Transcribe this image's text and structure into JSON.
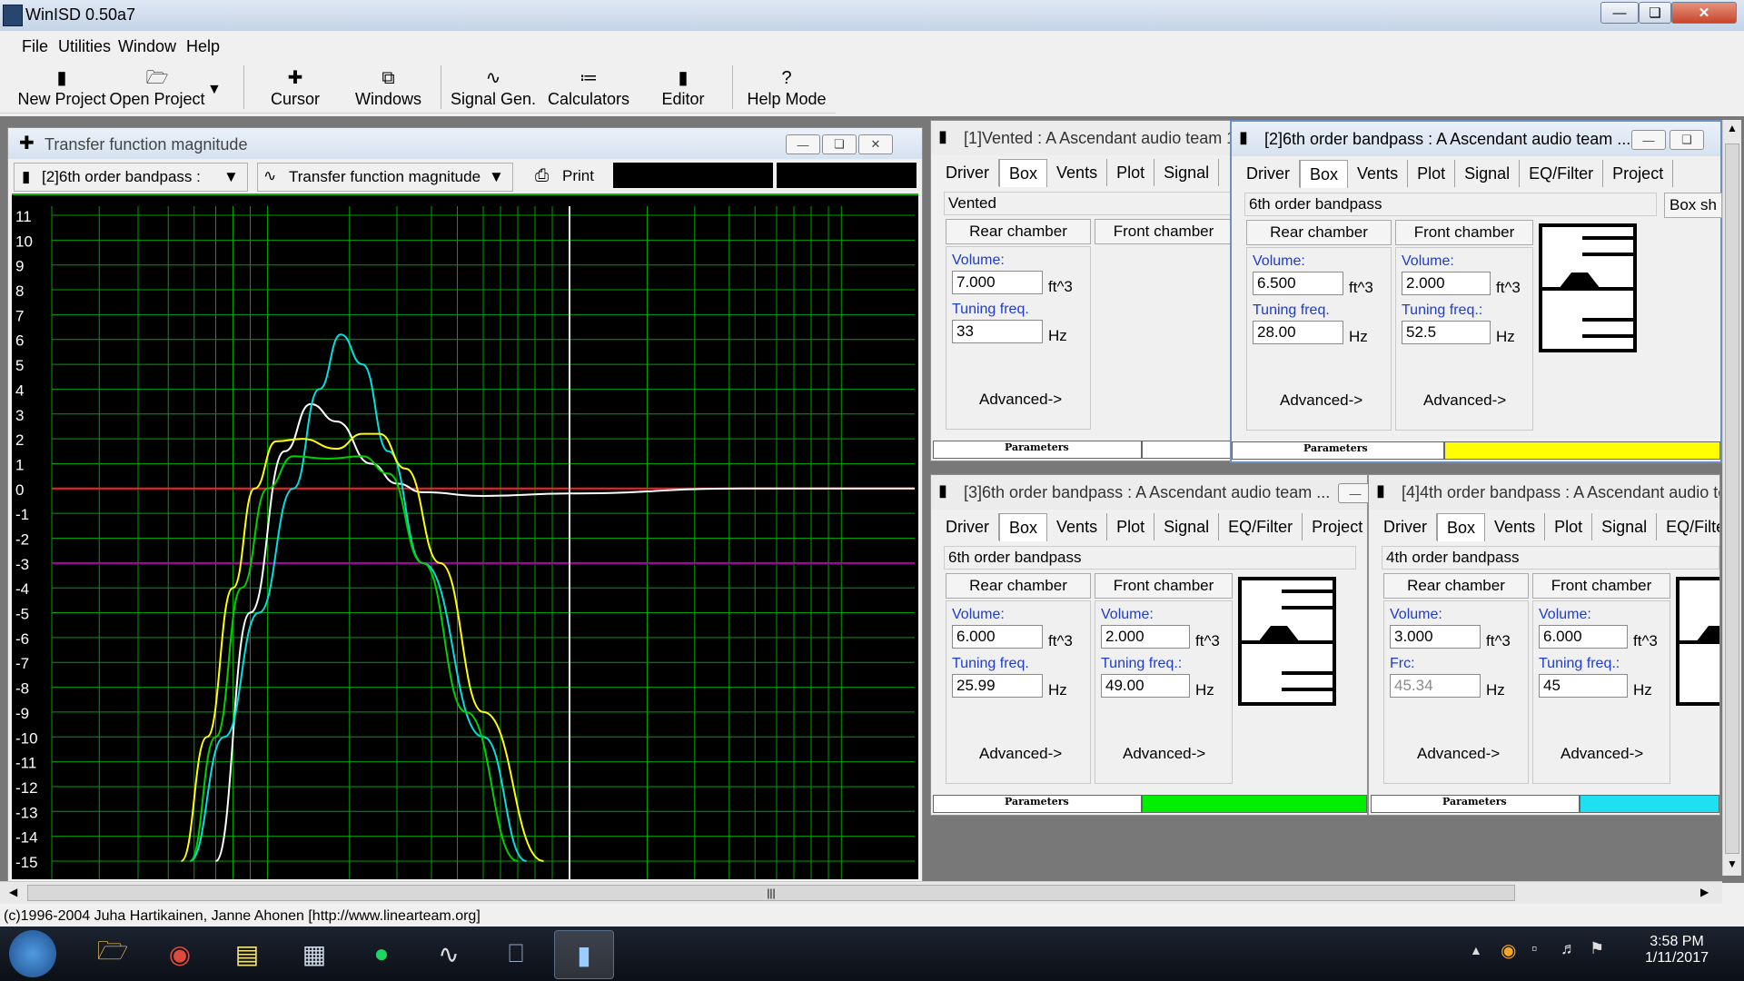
{
  "app": {
    "title": "WinISD 0.50a7"
  },
  "menu": [
    "File",
    "Utilities",
    "Window",
    "Help"
  ],
  "toolbar": [
    "New Project",
    "Open Project",
    "Cursor",
    "Windows",
    "Signal Gen.",
    "Calculators",
    "Editor",
    "Help Mode"
  ],
  "chart_window": {
    "title": "Transfer function magnitude",
    "project_select": "[2]6th order bandpass :",
    "graph_select": "Transfer function magnitude",
    "print_label": "Print"
  },
  "chart_data": {
    "type": "line",
    "y_ticks": [
      "11",
      "10",
      "9",
      "8",
      "7",
      "6",
      "5",
      "4",
      "3",
      "2",
      "1",
      "0",
      "-1",
      "-2",
      "-3",
      "-4",
      "-5",
      "-6",
      "-7",
      "-8",
      "-9",
      "-10",
      "-11",
      "-12",
      "-13",
      "-14",
      "-15"
    ],
    "ylim": [
      -15,
      11
    ],
    "grid": true,
    "cursor_line": true,
    "reference_lines": [
      {
        "y": 0,
        "color": "#ff2020"
      },
      {
        "y": -3,
        "color": "#b000b0"
      }
    ],
    "series": [
      {
        "color": "#ffffff",
        "values": [
          [
            0.19,
            -15
          ],
          [
            0.23,
            -5
          ],
          [
            0.27,
            1.5
          ],
          [
            0.3,
            3.4
          ],
          [
            0.33,
            2.7
          ],
          [
            0.37,
            1
          ],
          [
            0.4,
            0.2
          ],
          [
            0.43,
            -0.15
          ],
          [
            0.5,
            -0.3
          ],
          [
            0.6,
            -0.2
          ],
          [
            0.8,
            0
          ],
          [
            1,
            0
          ]
        ]
      },
      {
        "color": "#00e0e0",
        "values": [
          [
            0.16,
            -15
          ],
          [
            0.2,
            -10
          ],
          [
            0.24,
            -5
          ],
          [
            0.28,
            0
          ],
          [
            0.31,
            4
          ],
          [
            0.335,
            6.2
          ],
          [
            0.36,
            5
          ],
          [
            0.39,
            1.5
          ],
          [
            0.43,
            -3
          ],
          [
            0.5,
            -10
          ],
          [
            0.55,
            -15
          ]
        ]
      },
      {
        "color": "#ffff00",
        "values": [
          [
            0.15,
            -15
          ],
          [
            0.18,
            -10
          ],
          [
            0.21,
            -4
          ],
          [
            0.235,
            0
          ],
          [
            0.26,
            1.9
          ],
          [
            0.29,
            2
          ],
          [
            0.33,
            1.6
          ],
          [
            0.36,
            2.2
          ],
          [
            0.38,
            2.2
          ],
          [
            0.41,
            0.8
          ],
          [
            0.45,
            -3
          ],
          [
            0.5,
            -9
          ],
          [
            0.57,
            -15
          ]
        ]
      },
      {
        "color": "#00d000",
        "values": [
          [
            0.16,
            -15
          ],
          [
            0.19,
            -10
          ],
          [
            0.22,
            -4
          ],
          [
            0.25,
            0
          ],
          [
            0.28,
            1.3
          ],
          [
            0.32,
            1.2
          ],
          [
            0.36,
            1.3
          ],
          [
            0.39,
            0.6
          ],
          [
            0.43,
            -3
          ],
          [
            0.48,
            -9
          ],
          [
            0.54,
            -15
          ]
        ]
      }
    ]
  },
  "panels": [
    {
      "title": "[1]Vented : A Ascendant audio team 1",
      "tabs": [
        "Driver",
        "Box",
        "Vents",
        "Plot",
        "Signal"
      ],
      "box_type": "Vented",
      "rear": {
        "label": "Rear chamber",
        "volume": "7.000",
        "tuning_label": "Tuning freq.",
        "tuning": "33"
      },
      "front": {
        "label": "Front chamber"
      },
      "footer": "Parameters",
      "color": "#ffffff"
    },
    {
      "title": "[2]6th order bandpass : A Ascendant audio team ...",
      "tabs": [
        "Driver",
        "Box",
        "Vents",
        "Plot",
        "Signal",
        "EQ/Filter",
        "Project"
      ],
      "box_type": "6th order bandpass",
      "box_sh": "Box sh",
      "rear": {
        "label": "Rear chamber",
        "volume": "6.500",
        "tuning_label": "Tuning freq.",
        "tuning": "28.00"
      },
      "front": {
        "label": "Front chamber",
        "volume": "2.000",
        "tuning_label": "Tuning freq.:",
        "tuning": "52.5"
      },
      "footer": "Parameters",
      "color": "#ffff00"
    },
    {
      "title": "[3]6th order bandpass : A Ascendant audio team ...",
      "tabs": [
        "Driver",
        "Box",
        "Vents",
        "Plot",
        "Signal",
        "EQ/Filter",
        "Project"
      ],
      "box_type": "6th order bandpass",
      "rear": {
        "label": "Rear chamber",
        "volume": "6.000",
        "tuning_label": "Tuning freq.",
        "tuning": "25.99"
      },
      "front": {
        "label": "Front chamber",
        "volume": "2.000",
        "tuning_label": "Tuning freq.:",
        "tuning": "49.00"
      },
      "footer": "Parameters",
      "color": "#00ee00"
    },
    {
      "title": "[4]4th order bandpass : A Ascendant audio te",
      "tabs": [
        "Driver",
        "Box",
        "Vents",
        "Plot",
        "Signal",
        "EQ/Filte"
      ],
      "box_type": "4th order bandpass",
      "rear": {
        "label": "Rear chamber",
        "volume": "3.000",
        "tuning_label": "Frc:",
        "tuning": "45.34"
      },
      "front": {
        "label": "Front chamber",
        "volume": "6.000",
        "tuning_label": "Tuning freq.:",
        "tuning": "45"
      },
      "footer": "Parameters",
      "color": "#1ee0f0"
    }
  ],
  "units": {
    "volume": "ft^3",
    "freq": "Hz"
  },
  "advanced_label": "Advanced->",
  "statusbar": {
    "text": "(c)1996-2004 Juha Hartikainen, Janne Ahonen [http://www.linearteam.org]"
  },
  "taskbar": {
    "time": "3:58 PM",
    "date": "1/11/2017"
  }
}
